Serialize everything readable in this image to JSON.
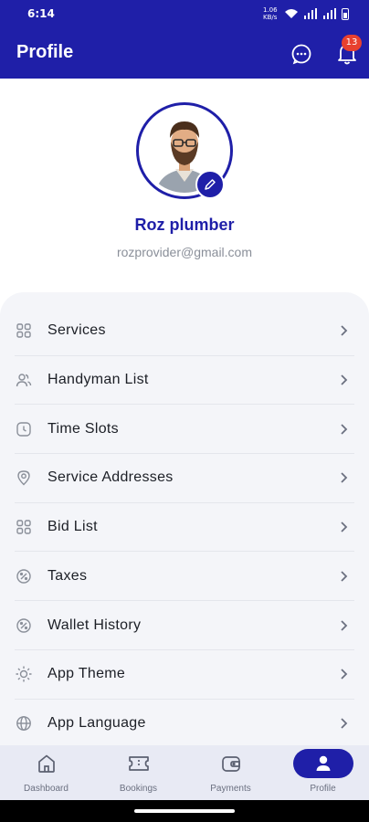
{
  "status_bar": {
    "time": "6:14",
    "speed": "1.06 KB/s"
  },
  "header": {
    "title": "Profile",
    "notification_count": "13"
  },
  "profile": {
    "name": "Roz plumber",
    "email": "rozprovider@gmail.com"
  },
  "menu": {
    "items": [
      {
        "label": "Services",
        "icon": "grid-icon"
      },
      {
        "label": "Handyman List",
        "icon": "users-icon"
      },
      {
        "label": "Time Slots",
        "icon": "clock-icon"
      },
      {
        "label": "Service Addresses",
        "icon": "location-pin-icon"
      },
      {
        "label": "Bid List",
        "icon": "grid-icon"
      },
      {
        "label": "Taxes",
        "icon": "percent-icon"
      },
      {
        "label": "Wallet History",
        "icon": "percent-icon"
      },
      {
        "label": "App Theme",
        "icon": "sun-icon"
      },
      {
        "label": "App Language",
        "icon": "globe-icon"
      }
    ]
  },
  "bottom_nav": {
    "items": [
      {
        "label": "Dashboard",
        "icon": "home-icon"
      },
      {
        "label": "Bookings",
        "icon": "ticket-icon"
      },
      {
        "label": "Payments",
        "icon": "wallet-icon"
      },
      {
        "label": "Profile",
        "icon": "user-icon"
      }
    ],
    "active": "Profile"
  },
  "colors": {
    "primary": "#1f1fa8",
    "badge": "#e8402f",
    "panel": "#f4f5f9"
  }
}
